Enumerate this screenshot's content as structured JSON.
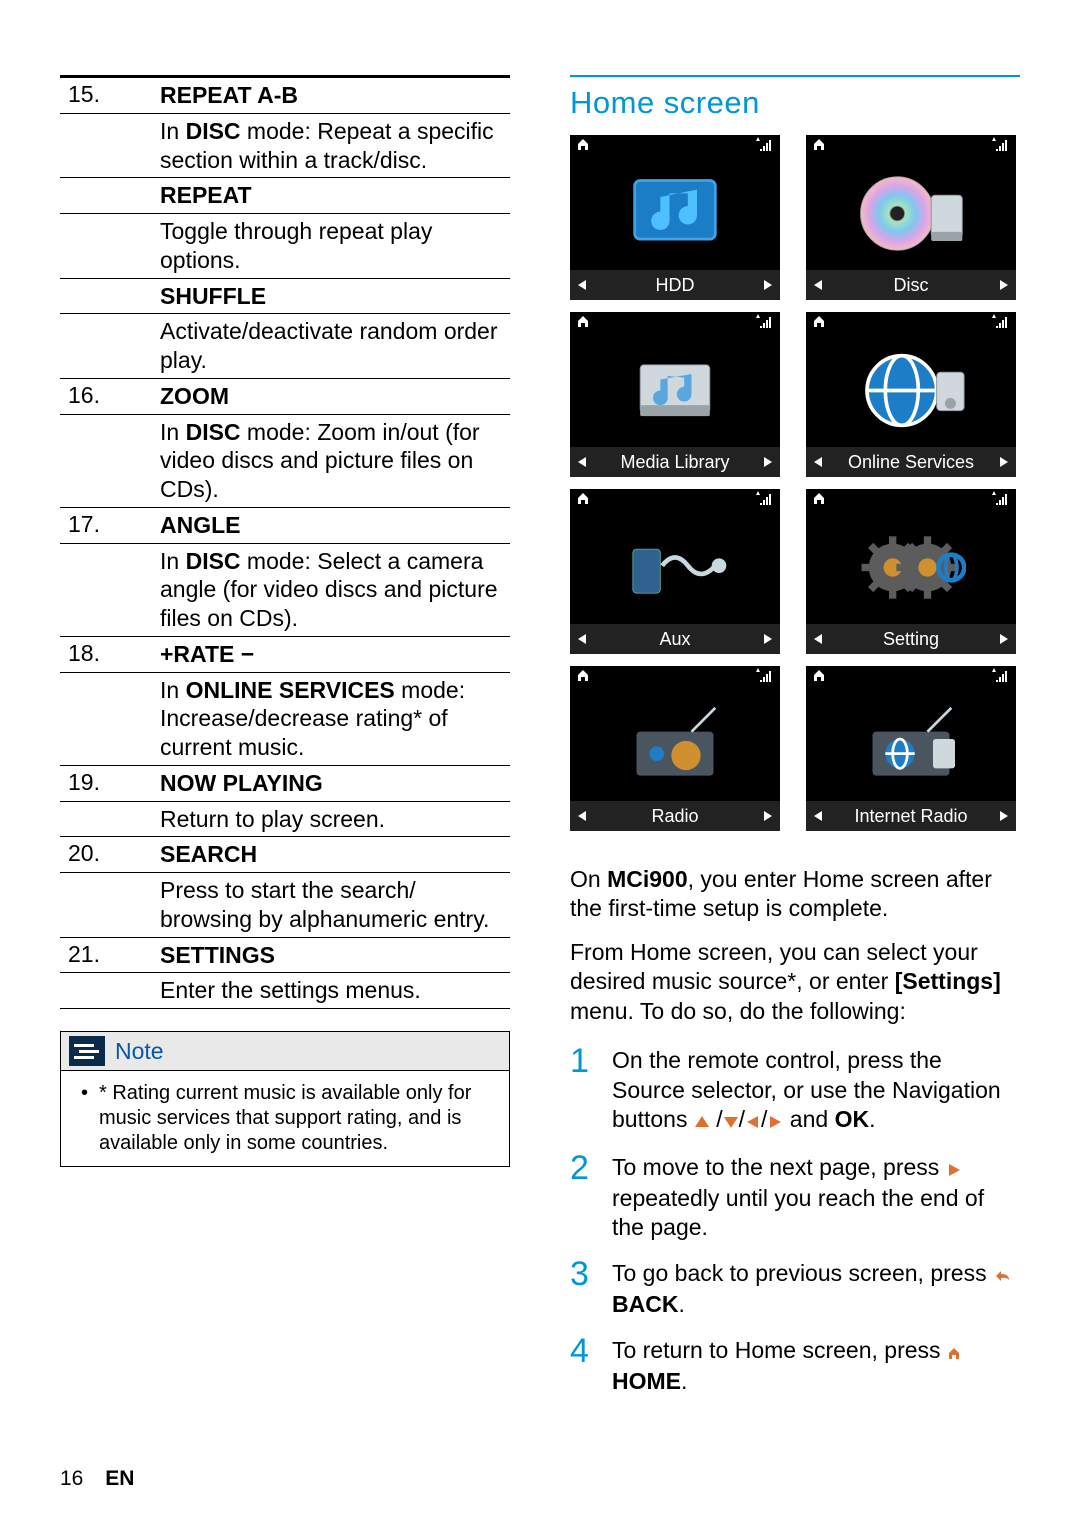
{
  "table": [
    {
      "num": "15.",
      "title": "REPEAT A-B",
      "desc_pre": "In ",
      "desc_bold": "DISC",
      "desc_post": " mode: Repeat a specific section within a track/disc."
    },
    {
      "num": "",
      "title": "REPEAT",
      "desc_pre": "",
      "desc_bold": "",
      "desc_post": "Toggle through repeat play options."
    },
    {
      "num": "",
      "title": "SHUFFLE",
      "desc_pre": "",
      "desc_bold": "",
      "desc_post": "Activate/deactivate random order play."
    },
    {
      "num": "16.",
      "title": "ZOOM",
      "desc_pre": "In ",
      "desc_bold": "DISC",
      "desc_post": " mode: Zoom in/out (for video discs and picture files on CDs)."
    },
    {
      "num": "17.",
      "title": "ANGLE",
      "desc_pre": "In ",
      "desc_bold": "DISC",
      "desc_post": " mode: Select a camera angle (for video discs and picture files on CDs)."
    },
    {
      "num": "18.",
      "title": "+RATE −",
      "desc_pre": "In ",
      "desc_bold": "ONLINE SERVICES",
      "desc_post": " mode: Increase/decrease rating* of current music."
    },
    {
      "num": "19.",
      "title": "NOW PLAYING",
      "desc_pre": "",
      "desc_bold": "",
      "desc_post": "Return to play screen."
    },
    {
      "num": "20.",
      "title": "SEARCH",
      "desc_pre": "",
      "desc_bold": "",
      "desc_post": "Press to start the search/ browsing by alphanumeric entry."
    },
    {
      "num": "21.",
      "title": "SETTINGS",
      "desc_pre": "",
      "desc_bold": "",
      "desc_post": "Enter the settings menus."
    }
  ],
  "note": {
    "heading": "Note",
    "bullet": "•",
    "text": "* Rating current music is available only for music services that support rating, and is available only in some countries."
  },
  "right": {
    "heading": "Home screen",
    "tiles": [
      "HDD",
      "Disc",
      "Media Library",
      "Online Services",
      "Aux",
      "Setting",
      "Radio",
      "Internet Radio"
    ],
    "p1_a": "On ",
    "p1_bold": "MCi900",
    "p1_b": ", you enter Home screen after the first-time setup is complete.",
    "p2_a": "From Home screen, you can select your desired music source*, or enter ",
    "p2_bold": "[Settings]",
    "p2_b": " menu. To do so, do the following:",
    "steps": [
      {
        "n": "1",
        "a": "On the remote control, press the Source selector, or use the Navigation buttons ",
        "b": " and ",
        "ok": "OK",
        "c": "."
      },
      {
        "n": "2",
        "a": "To move to the next page, press ",
        "b": " repeatedly until you reach the end of the page."
      },
      {
        "n": "3",
        "a": "To go back to previous screen, press ",
        "back": "BACK",
        "c": "."
      },
      {
        "n": "4",
        "a": "To return to Home screen, press ",
        "home": "HOME",
        "c": "."
      }
    ]
  },
  "footer": {
    "page": "16",
    "lang": "EN"
  },
  "tri_slash": "/"
}
